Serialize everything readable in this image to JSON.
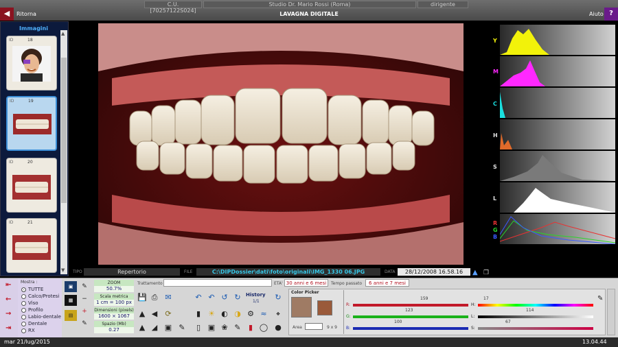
{
  "header": {
    "code": "C.U. [70257122S024]",
    "studio": "Studio Dr. Mario Rossi (Roma)",
    "role": "dirigente",
    "back_label": "Ritorna",
    "title": "LAVAGNA DIGITALE",
    "help_label": "Aiuto",
    "help_symbol": "?"
  },
  "sidebar": {
    "title": "Immagini",
    "items": [
      {
        "id_label": "ID",
        "id": "18"
      },
      {
        "id_label": "ID",
        "id": "19"
      },
      {
        "id_label": "ID",
        "id": "20"
      },
      {
        "id_label": "ID",
        "id": "21"
      }
    ]
  },
  "histograms": {
    "labels": [
      "Y",
      "M",
      "C",
      "H",
      "S",
      "L"
    ],
    "rgb_labels": [
      "R",
      "G",
      "B"
    ]
  },
  "file_bar": {
    "tipo_label": "TIPO",
    "tipo": "Repertorio",
    "file_label": "FILE",
    "file": "C:\\DIPDossier\\dati\\foto\\originali\\IMG_1330 06.JPG",
    "data_label": "DATA",
    "date": "28/12/2008 16.58.16"
  },
  "filters": {
    "title": "Mostra :",
    "options": [
      "TUTTE",
      "Calco/Protesi",
      "Viso",
      "Profilo",
      "Labio-dentale",
      "Dentale",
      "RX"
    ]
  },
  "zoom": {
    "zoom_label": "ZOOM",
    "zoom_value": "50.7%",
    "scale_label": "Scala metrica",
    "scale_value": "1 cm = 100 px",
    "dim_label": "Dimensioni (pixels)",
    "dim_value": "1600 × 1067",
    "space_label": "Spazio (Mb)",
    "space_value": "0.27"
  },
  "treatment": {
    "label": "Trattamento",
    "value": "",
    "eta_label": "ETA'",
    "eta": "30 anni e 6 mesi",
    "elapsed_label": "Tempo passato",
    "elapsed": "6 anni e 7 mesi"
  },
  "history": {
    "label": "History",
    "count": "1/1"
  },
  "color_picker": {
    "title": "Color Picker",
    "area_label": "Area",
    "area_size": "9 x 9",
    "R": "159",
    "G": "123",
    "B": "100",
    "H": "17",
    "L": "114",
    "S": "67"
  },
  "status": {
    "date": "mar 21/lug/2015",
    "time": "13.04.44"
  }
}
